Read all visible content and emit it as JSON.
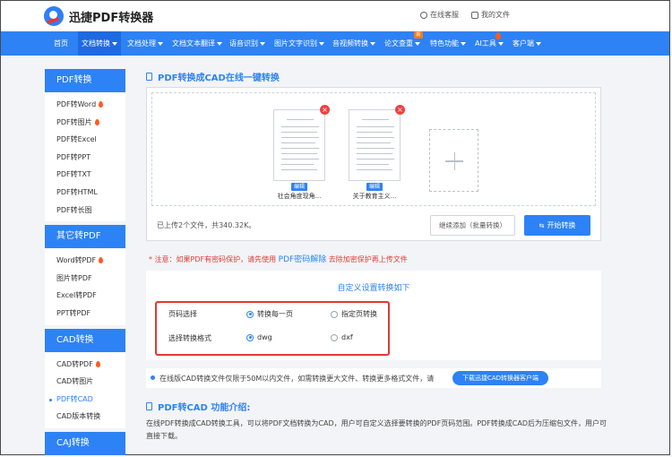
{
  "header": {
    "logo_text": "迅捷PDF转换器",
    "links": [
      {
        "label": "在线客服",
        "icon": "headset-icon"
      },
      {
        "label": "我的文件",
        "icon": "file-icon"
      }
    ]
  },
  "nav": {
    "items": [
      {
        "label": "首页"
      },
      {
        "label": "文档转换"
      },
      {
        "label": "文档处理"
      },
      {
        "label": "文档文本翻译"
      },
      {
        "label": "语音识别"
      },
      {
        "label": "图片文字识别"
      },
      {
        "label": "音视频转换"
      },
      {
        "label": "论文查重",
        "badge": "新"
      },
      {
        "label": "特色功能"
      },
      {
        "label": "AI工具"
      },
      {
        "label": "客户端"
      }
    ],
    "active": "文档转换"
  },
  "sidebar": {
    "sections": [
      {
        "title": "PDF转换",
        "items": [
          {
            "label": "PDF转Word",
            "hot": true
          },
          {
            "label": "PDF转图片",
            "hot": true
          },
          {
            "label": "PDF转Excel"
          },
          {
            "label": "PDF转PPT"
          },
          {
            "label": "PDF转TXT"
          },
          {
            "label": "PDF转HTML"
          },
          {
            "label": "PDF转长图"
          }
        ]
      },
      {
        "title": "其它转PDF",
        "items": [
          {
            "label": "Word转PDF",
            "hot": true
          },
          {
            "label": "图片转PDF"
          },
          {
            "label": "Excel转PDF"
          },
          {
            "label": "PPT转PDF"
          }
        ]
      },
      {
        "title": "CAD转换",
        "items": [
          {
            "label": "CAD转PDF",
            "hot": true
          },
          {
            "label": "CAD转图片"
          },
          {
            "label": "PDF转CAD",
            "active": true
          },
          {
            "label": "CAD版本转换"
          }
        ]
      },
      {
        "title": "CAJ转换",
        "items": []
      }
    ]
  },
  "main": {
    "title": "PDF转换成CAD在线一键转换",
    "files": [
      {
        "name": "社会角度现角...",
        "edit_label": "编辑"
      },
      {
        "name": "关于教育主义...",
        "edit_label": "编辑"
      }
    ],
    "upload_status": "已上传2个文件，共340.32K。",
    "continue_button": "继续添加（批量转换）",
    "start_button": "开始转换",
    "notice": {
      "prefix": "*  注意：如果PDF有密码保护，请先使用 ",
      "link": "PDF密码解除",
      "suffix": " 去除加密保护再上传文件"
    },
    "settings": {
      "title": "自定义设置转换如下",
      "rows": [
        {
          "label": "页码选择",
          "options": [
            {
              "label": "转换每一页",
              "selected": true
            },
            {
              "label": "指定页转换",
              "selected": false
            }
          ]
        },
        {
          "label": "选择转换格式",
          "options": [
            {
              "label": "dwg",
              "selected": true
            },
            {
              "label": "dxf",
              "selected": false
            }
          ]
        }
      ]
    },
    "info": {
      "text": "在线版CAD转换文件仅限于50M以内文件，如需转换更大文件、转换更多格式文件，请",
      "button": "下载迅捷CAD转换器客户端"
    },
    "function": {
      "title": "PDF转CAD 功能介绍:",
      "description": "在线PDF转换成CAD转换工具，可以将PDF文档转换为CAD，用户可自定义选择要转换的PDF页码范围。PDF转换成CAD后为压缩包文件，用户可直接下载。"
    }
  },
  "colors": {
    "primary": "#2d82f5",
    "alert": "#e53935",
    "hot": "#ff5a1f"
  }
}
